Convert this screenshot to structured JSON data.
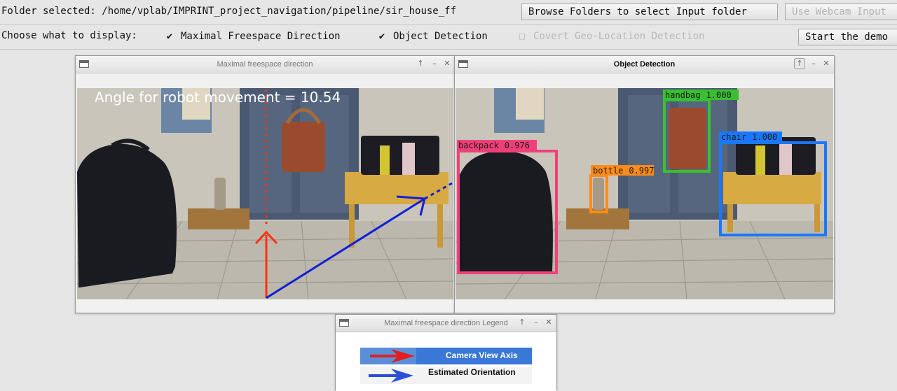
{
  "toolbar": {
    "folder_label": "Folder selected: /home/vplab/IMPRINT_project_navigation/pipeline/sir_house_ff",
    "browse_button": "Browse Folders to select Input folder",
    "webcam_button": "Use Webcam Input",
    "display_label": "Choose what to display:",
    "start_button": "Start the demo",
    "checkboxes": [
      {
        "label": "Maximal Freespace Direction",
        "checked": true,
        "enabled": true
      },
      {
        "label": "Object Detection",
        "checked": true,
        "enabled": true
      },
      {
        "label": "Covert Geo-Location Detection",
        "checked": false,
        "enabled": false
      }
    ]
  },
  "windows": {
    "freespace": {
      "title": "Maximal freespace direction",
      "overlay_text": "Angle for robot movement = 10.54",
      "arrow_colors": {
        "camera_axis": "#ff3010",
        "orientation": "#1020d8"
      }
    },
    "detection": {
      "title": "Object Detection",
      "detections": [
        {
          "label": "backpack",
          "score": "0.976",
          "color": "#f0407a"
        },
        {
          "label": "bottle",
          "score": "0.997",
          "color": "#ff8c1a"
        },
        {
          "label": "handbag",
          "score": "1.000",
          "color": "#38c030"
        },
        {
          "label": "chair",
          "score": "1.000",
          "color": "#1a78ff"
        }
      ]
    },
    "legend": {
      "title": "Maximal freespace direction Legend",
      "items": [
        {
          "label": "Camera View Axis",
          "arrow_color": "#e02020",
          "bg": "#3a78d8"
        },
        {
          "label": "Estimated Orientation",
          "arrow_color": "#2a4fd8",
          "bg": "#f3f3f3"
        }
      ]
    }
  },
  "icons": {
    "window_menu": "window-menu-icon",
    "pin": "pin-icon",
    "minimize": "minimize-icon",
    "close": "close-icon",
    "checkbox": "checkbox-icon"
  }
}
